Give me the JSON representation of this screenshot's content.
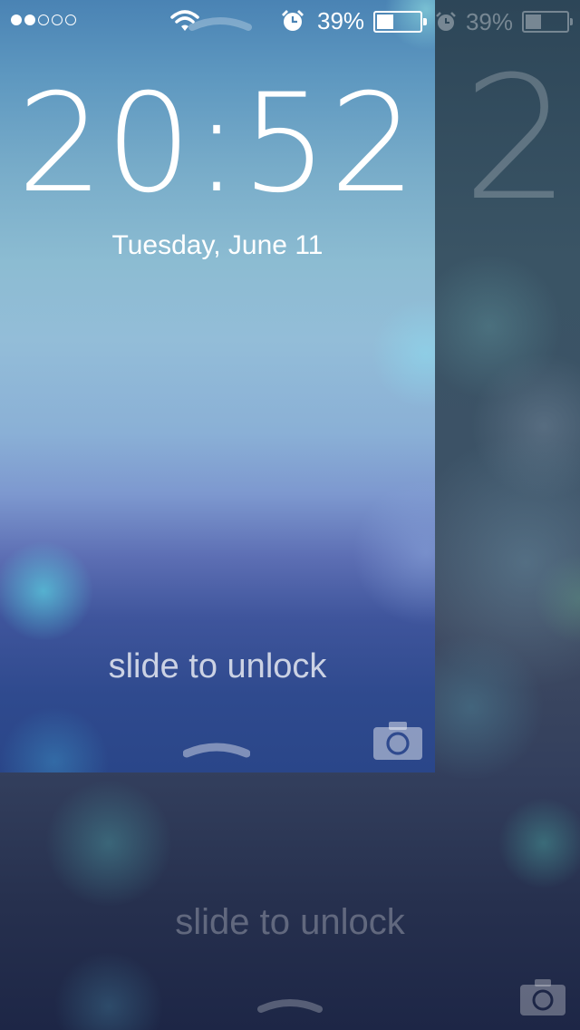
{
  "status_bar": {
    "signal_filled": 2,
    "signal_total": 5,
    "battery_percent_label": "39%",
    "battery_level": 0.39
  },
  "lock_screen": {
    "time": "20:52",
    "date": "Tuesday, June 11",
    "slide_label": "slide to unlock"
  },
  "background_screen": {
    "time_partial": "2",
    "battery_percent_label": "39%",
    "slide_label": "slide to unlock"
  },
  "icons": {
    "signal": "signal-dots-icon",
    "wifi": "wifi-icon",
    "alarm": "alarm-clock-icon",
    "battery": "battery-icon",
    "grabber": "chevron-up-icon",
    "camera": "camera-icon"
  }
}
